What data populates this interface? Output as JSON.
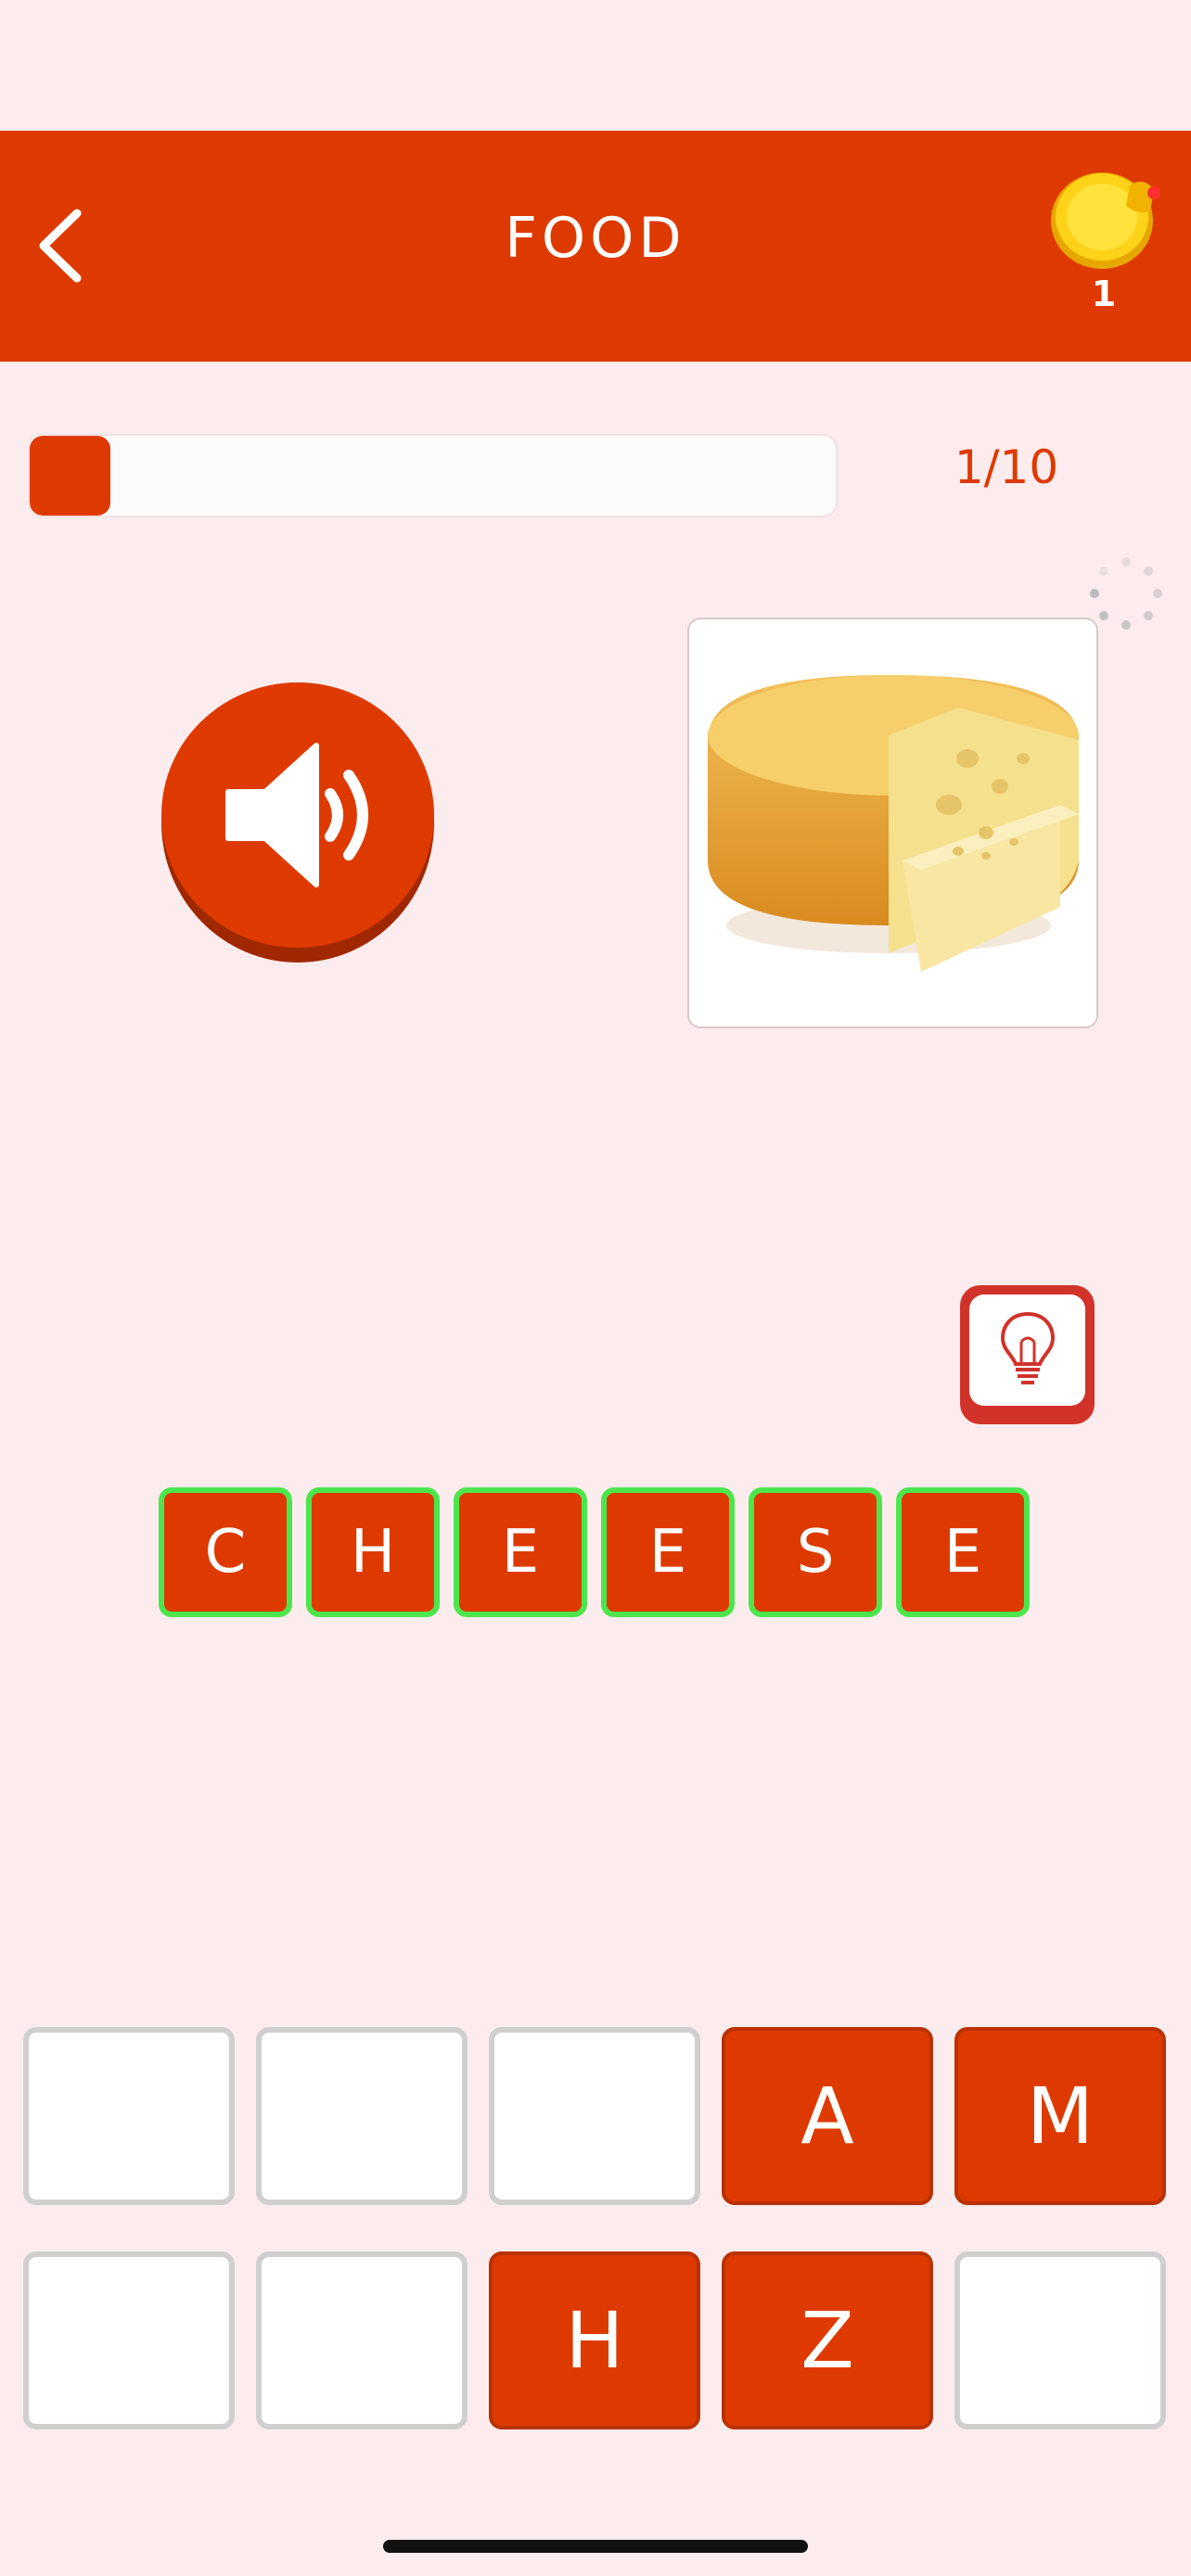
{
  "header": {
    "title": "FOOD",
    "coin_count": "1",
    "back_icon": "chevron-left-icon",
    "coin_icon": "gold-coin-bell-icon"
  },
  "progress": {
    "text": "1/10",
    "fraction": 0.1
  },
  "speaker": {
    "icon": "speaker-icon"
  },
  "picture": {
    "subject": "cheese-wheel"
  },
  "hint": {
    "icon": "lightbulb-icon"
  },
  "answer": [
    "C",
    "H",
    "E",
    "E",
    "S",
    "E"
  ],
  "keyboard": [
    {
      "letter": "",
      "state": "empty"
    },
    {
      "letter": "",
      "state": "empty"
    },
    {
      "letter": "",
      "state": "empty"
    },
    {
      "letter": "A",
      "state": "filled"
    },
    {
      "letter": "M",
      "state": "filled"
    },
    {
      "letter": "",
      "state": "empty"
    },
    {
      "letter": "",
      "state": "empty"
    },
    {
      "letter": "H",
      "state": "filled"
    },
    {
      "letter": "Z",
      "state": "filled"
    },
    {
      "letter": "",
      "state": "empty"
    }
  ],
  "colors": {
    "accent": "#de3a00",
    "background": "#fdeced",
    "correct_border": "#4ce64c"
  }
}
